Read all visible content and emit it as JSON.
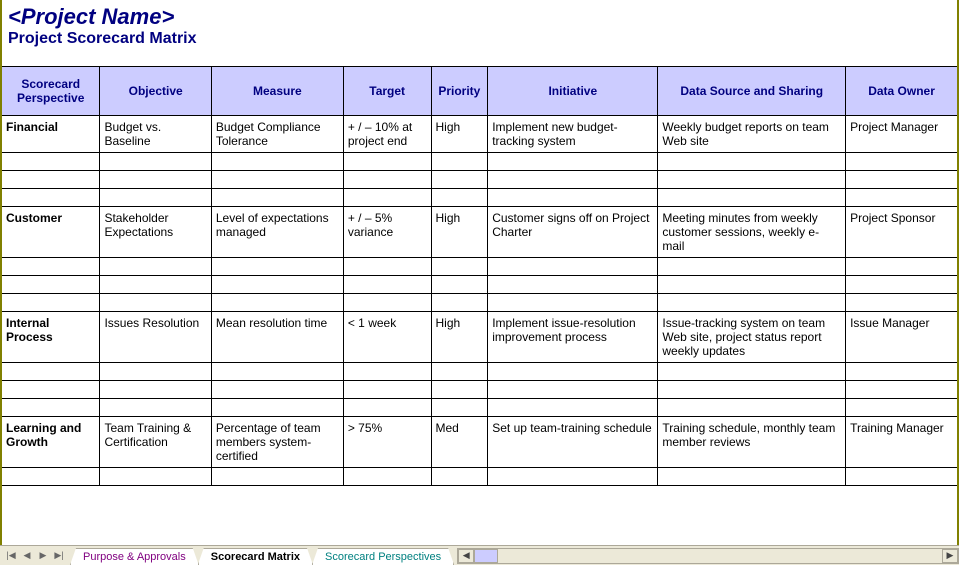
{
  "title": "<Project Name>",
  "subtitle": "Project Scorecard Matrix",
  "headers": {
    "perspective": "Scorecard Perspective",
    "objective": "Objective",
    "measure": "Measure",
    "target": "Target",
    "priority": "Priority",
    "initiative": "Initiative",
    "datasource": "Data Source and Sharing",
    "dataowner": "Data Owner"
  },
  "rows": [
    {
      "perspective": "Financial",
      "objective": "Budget vs. Baseline",
      "measure": "Budget Compliance Tolerance",
      "target": "+ / – 10% at project end",
      "priority": "High",
      "initiative": "Implement new budget-tracking system",
      "datasource": "Weekly budget reports on team Web site",
      "dataowner": "Project Manager"
    },
    {
      "perspective": "Customer",
      "objective": "Stakeholder Expectations",
      "measure": "Level of expectations managed",
      "target": "+ / – 5% variance",
      "priority": "High",
      "initiative": "Customer signs off on Project Charter",
      "datasource": "Meeting minutes from weekly customer sessions, weekly e-mail",
      "dataowner": "Project Sponsor"
    },
    {
      "perspective": "Internal Process",
      "objective": "Issues Resolution",
      "measure": "Mean resolution time",
      "target": "< 1 week",
      "priority": "High",
      "initiative": "Implement issue-resolution improvement process",
      "datasource": "Issue-tracking system on team Web site, project status report weekly updates",
      "dataowner": "Issue Manager"
    },
    {
      "perspective": "Learning and Growth",
      "objective": "Team Training & Certification",
      "measure": "Percentage of team members system-certified",
      "target": "> 75%",
      "priority": "Med",
      "initiative": "Set up team-training schedule",
      "datasource": "Training schedule, monthly team member reviews",
      "dataowner": "Training Manager"
    }
  ],
  "tabs": {
    "tab1": "Purpose & Approvals",
    "tab2": "Scorecard Matrix",
    "tab3": "Scorecard Perspectives"
  }
}
